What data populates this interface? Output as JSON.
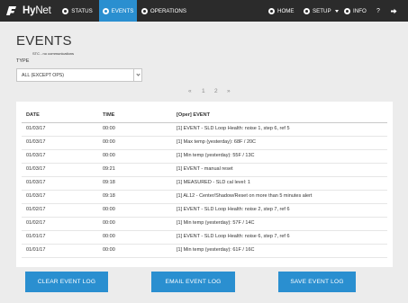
{
  "brand": {
    "hy": "Hy",
    "net": "Net"
  },
  "nav": {
    "status": "STATUS",
    "events": "EVENTS",
    "operations": "OPERATIONS",
    "home": "HOME",
    "setup": "SETUP",
    "info": "INFO",
    "help": "?",
    "logout_icon": "logout-icon"
  },
  "page": {
    "title": "EVENTS",
    "status_note": "STC - no communications",
    "type_label": "TYPE",
    "type_selected": "ALL (EXCEPT OPS)"
  },
  "pagination": {
    "prev": "«",
    "pages": [
      "1",
      "2"
    ],
    "next": "»"
  },
  "table": {
    "headers": {
      "date": "DATE",
      "time": "TIME",
      "event": "[Oper] EVENT"
    },
    "rows": [
      {
        "date": "01/03/17",
        "time": "00:00",
        "event": "[1] EVENT - SLD Loop Health: noise 1, step 6, ref 5"
      },
      {
        "date": "01/03/17",
        "time": "00:00",
        "event": "[1] Max temp (yesterday): 68F / 20C"
      },
      {
        "date": "01/03/17",
        "time": "00:00",
        "event": "[1] Min temp (yesterday): 55F / 13C"
      },
      {
        "date": "01/03/17",
        "time": "09:21",
        "event": "[1] EVENT - manual reset"
      },
      {
        "date": "01/03/17",
        "time": "09:18",
        "event": "[1] MEASURED - SLD cal level: 1"
      },
      {
        "date": "01/03/17",
        "time": "09:18",
        "event": "[1] AL12 - Center/Shadow/Reset on more than 5 minutes alert"
      },
      {
        "date": "01/02/17",
        "time": "00:00",
        "event": "[1] EVENT - SLD Loop Health: noise 2, step 7, ref 6"
      },
      {
        "date": "01/02/17",
        "time": "00:00",
        "event": "[1] Min temp (yesterday): 57F / 14C"
      },
      {
        "date": "01/01/17",
        "time": "00:00",
        "event": "[1] EVENT - SLD Loop Health: noise 6, step 7, ref 6"
      },
      {
        "date": "01/01/17",
        "time": "00:00",
        "event": "[1] Min temp (yesterday): 61F / 16C"
      }
    ]
  },
  "actions": {
    "clear": "CLEAR EVENT LOG",
    "email": "EMAIL EVENT LOG",
    "save": "SAVE EVENT LOG"
  },
  "colors": {
    "nav_bg": "#2b2b2b",
    "accent": "#2a8fd0",
    "page_bg": "#ececec"
  }
}
